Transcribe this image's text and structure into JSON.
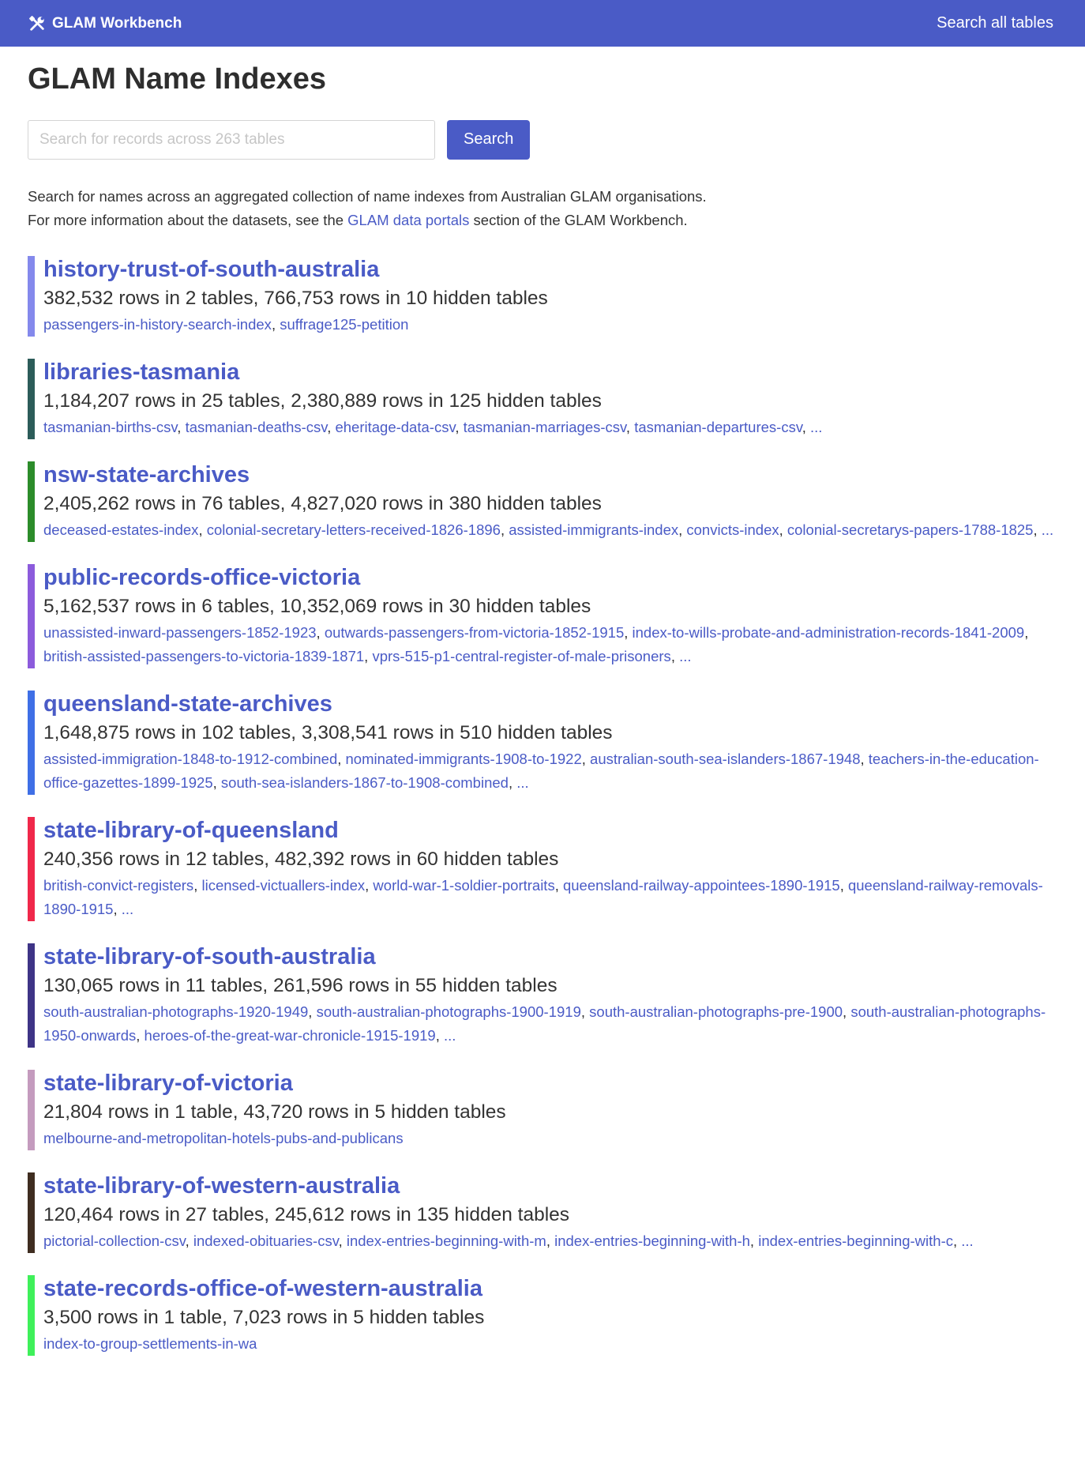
{
  "navbar": {
    "brand": "GLAM Workbench",
    "brand_icon": "tools-icon",
    "right_link": "Search all tables"
  },
  "page": {
    "title": "GLAM Name Indexes"
  },
  "search": {
    "placeholder": "Search for records across 263 tables",
    "value": "",
    "button_label": "Search"
  },
  "intro": {
    "line1": "Search for names across an aggregated collection of name indexes from Australian GLAM organisations.",
    "line2_before": "For more information about the datasets, see the ",
    "line2_link": "GLAM data portals",
    "line2_after": " section of the GLAM Workbench."
  },
  "colors": {
    "accent": "#4a5bc6",
    "text": "#333333"
  },
  "databases": [
    {
      "name": "history-trust-of-south-australia",
      "color": "#8489ec",
      "summary": "382,532 rows in 2 tables, 766,753 rows in 10 hidden tables",
      "tables": [
        "passengers-in-history-search-index",
        "suffrage125-petition"
      ],
      "more": ""
    },
    {
      "name": "libraries-tasmania",
      "color": "#2c5c59",
      "summary": "1,184,207 rows in 25 tables, 2,380,889 rows in 125 hidden tables",
      "tables": [
        "tasmanian-births-csv",
        "tasmanian-deaths-csv",
        "eheritage-data-csv",
        "tasmanian-marriages-csv",
        "tasmanian-departures-csv"
      ],
      "more": "..."
    },
    {
      "name": "nsw-state-archives",
      "color": "#2c8c2a",
      "summary": "2,405,262 rows in 76 tables, 4,827,020 rows in 380 hidden tables",
      "tables": [
        "deceased-estates-index",
        "colonial-secretary-letters-received-1826-1896",
        "assisted-immigrants-index",
        "convicts-index",
        "colonial-secretarys-papers-1788-1825"
      ],
      "more": "..."
    },
    {
      "name": "public-records-office-victoria",
      "color": "#8c5bdc",
      "summary": "5,162,537 rows in 6 tables, 10,352,069 rows in 30 hidden tables",
      "tables": [
        "unassisted-inward-passengers-1852-1923",
        "outwards-passengers-from-victoria-1852-1915",
        "index-to-wills-probate-and-administration-records-1841-2009",
        "british-assisted-passengers-to-victoria-1839-1871",
        "vprs-515-p1-central-register-of-male-prisoners"
      ],
      "more": "..."
    },
    {
      "name": "queensland-state-archives",
      "color": "#3f6fe6",
      "summary": "1,648,875 rows in 102 tables, 3,308,541 rows in 510 hidden tables",
      "tables": [
        "assisted-immigration-1848-to-1912-combined",
        "nominated-immigrants-1908-to-1922",
        "australian-south-sea-islanders-1867-1948",
        "teachers-in-the-education-office-gazettes-1899-1925",
        "south-sea-islanders-1867-to-1908-combined"
      ],
      "more": "..."
    },
    {
      "name": "state-library-of-queensland",
      "color": "#f0284a",
      "summary": "240,356 rows in 12 tables, 482,392 rows in 60 hidden tables",
      "tables": [
        "british-convict-registers",
        "licensed-victuallers-index",
        "world-war-1-soldier-portraits",
        "queensland-railway-appointees-1890-1915",
        "queensland-railway-removals-1890-1915"
      ],
      "more": "..."
    },
    {
      "name": "state-library-of-south-australia",
      "color": "#3e3486",
      "summary": "130,065 rows in 11 tables, 261,596 rows in 55 hidden tables",
      "tables": [
        "south-australian-photographs-1920-1949",
        "south-australian-photographs-1900-1919",
        "south-australian-photographs-pre-1900",
        "south-australian-photographs-1950-onwards",
        "heroes-of-the-great-war-chronicle-1915-1919"
      ],
      "more": "..."
    },
    {
      "name": "state-library-of-victoria",
      "color": "#c49bbe",
      "summary": "21,804 rows in 1 table, 43,720 rows in 5 hidden tables",
      "tables": [
        "melbourne-and-metropolitan-hotels-pubs-and-publicans"
      ],
      "more": ""
    },
    {
      "name": "state-library-of-western-australia",
      "color": "#3f2d20",
      "summary": "120,464 rows in 27 tables, 245,612 rows in 135 hidden tables",
      "tables": [
        "pictorial-collection-csv",
        "indexed-obituaries-csv",
        "index-entries-beginning-with-m",
        "index-entries-beginning-with-h",
        "index-entries-beginning-with-c"
      ],
      "more": "..."
    },
    {
      "name": "state-records-office-of-western-australia",
      "color": "#3ff05a",
      "summary": "3,500 rows in 1 table, 7,023 rows in 5 hidden tables",
      "tables": [
        "index-to-group-settlements-in-wa"
      ],
      "more": ""
    }
  ]
}
